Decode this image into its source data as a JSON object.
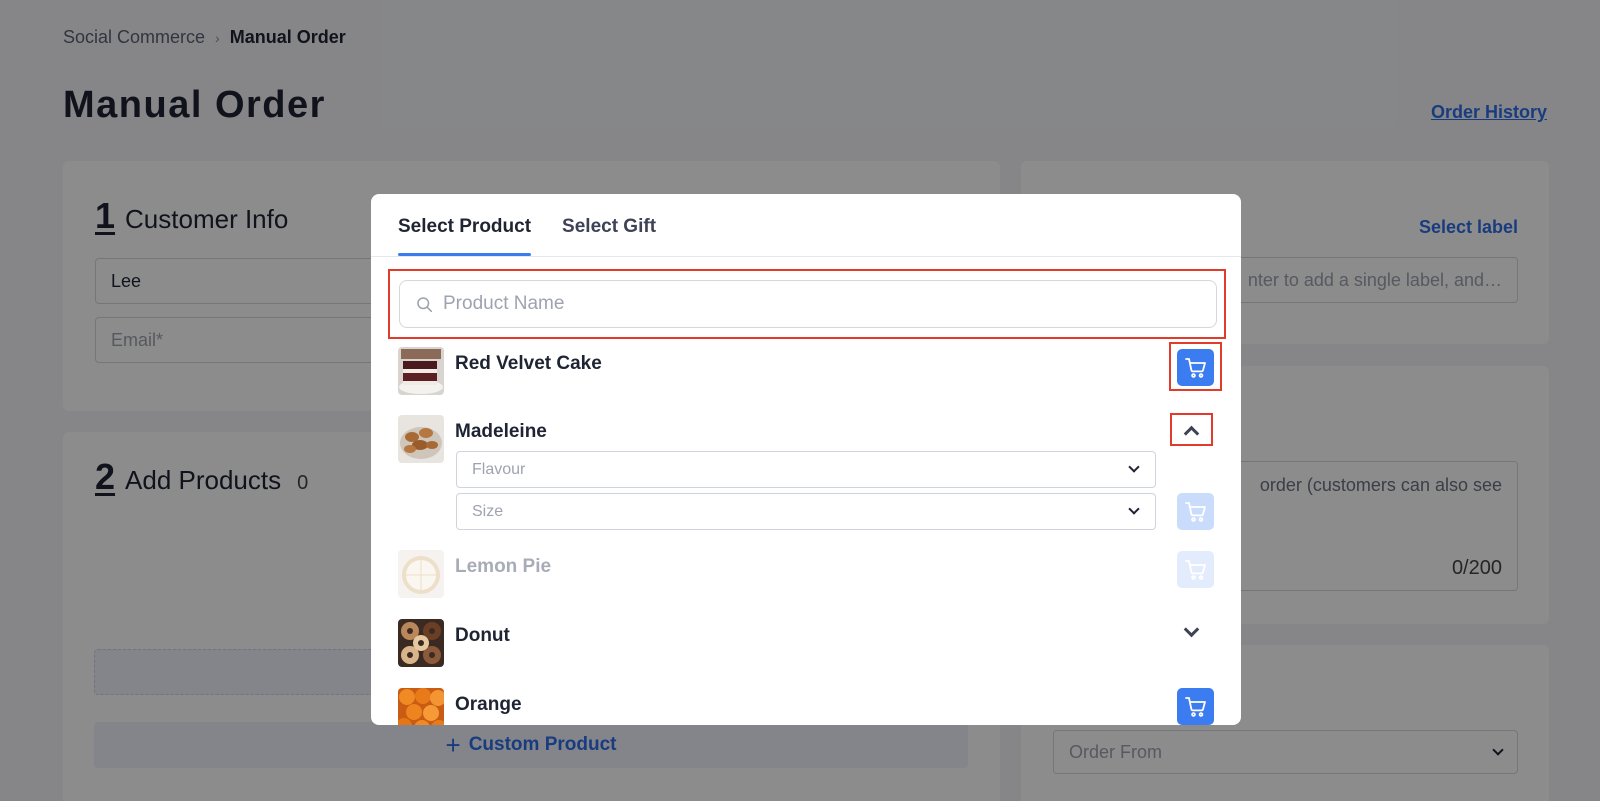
{
  "breadcrumb": {
    "parent": "Social Commerce",
    "current": "Manual Order"
  },
  "page": {
    "title": "Manual Order",
    "order_history_link": "Order History"
  },
  "customer": {
    "step_number": "1",
    "title": "Customer Info",
    "name_value": "Lee",
    "email_placeholder": "Email*"
  },
  "products_section": {
    "step_number": "2",
    "title": "Add Products",
    "count": "0",
    "custom_product_label": "Custom Product"
  },
  "right_panel": {
    "select_label_link": "Select label",
    "label_input_placeholder": "nter to add a single label, and…",
    "note_text": "order (customers can also see",
    "note_counter": "0/200",
    "order_from_placeholder": "Order From"
  },
  "modal": {
    "tabs": [
      {
        "label": "Select Product",
        "active": true
      },
      {
        "label": "Select Gift",
        "active": false
      }
    ],
    "search_placeholder": "Product Name",
    "products": [
      {
        "name": "Red Velvet Cake",
        "action": "add-to-cart"
      },
      {
        "name": "Madeleine",
        "action": "collapse",
        "options": [
          "Flavour",
          "Size"
        ]
      },
      {
        "name": "Lemon Pie",
        "action": "add-to-cart-disabled"
      },
      {
        "name": "Donut",
        "action": "expand"
      },
      {
        "name": "Orange",
        "action": "add-to-cart"
      }
    ]
  },
  "colors": {
    "accent": "#3b7cf0",
    "link": "#2f6ee8",
    "highlight_border": "#e13b2b",
    "overlay": "rgba(0,0,0,0.45)"
  }
}
